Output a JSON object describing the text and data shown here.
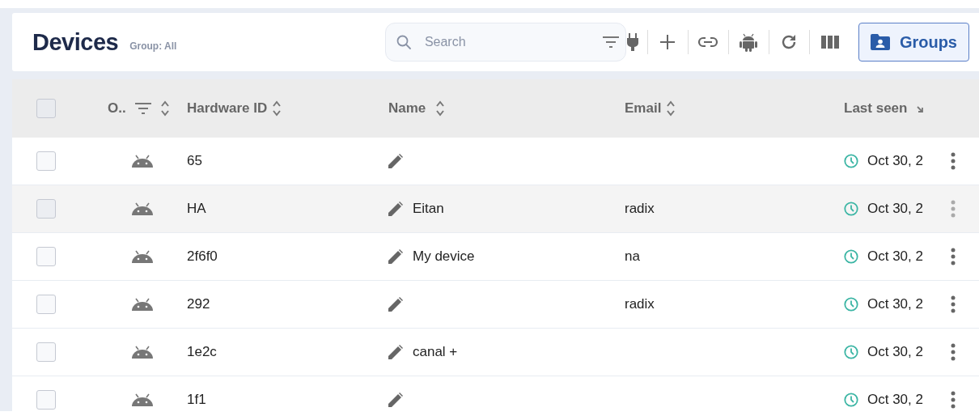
{
  "header": {
    "title": "Devices",
    "subtitle": "Group: All",
    "search": {
      "placeholder": "Search"
    },
    "groups_button": "Groups"
  },
  "table": {
    "select_all": {
      "checked": false
    },
    "columns": [
      {
        "label": "O..",
        "filterable": true,
        "sorted_desc": false
      },
      {
        "label": "Hardware ID",
        "filterable": false,
        "sorted_desc": false
      },
      {
        "label": "Name",
        "filterable": false,
        "sorted_desc": false
      },
      {
        "label": "Email",
        "filterable": false,
        "sorted_desc": false
      },
      {
        "label": "Last seen",
        "filterable": false,
        "sorted_desc": true
      }
    ],
    "rows": [
      {
        "checked": false,
        "hovered": false,
        "hardware_id": "65",
        "last_seen": "Oct 30, 2"
      },
      {
        "checked": false,
        "hovered": true,
        "hardware_id": "HA",
        "name": "Eitan",
        "email": "radix",
        "last_seen": "Oct 30, 2"
      },
      {
        "checked": false,
        "hovered": false,
        "hardware_id": "2f6f0",
        "name": "My device",
        "email": "na",
        "last_seen": "Oct 30, 2"
      },
      {
        "checked": false,
        "hovered": false,
        "hardware_id": "292",
        "email": "radix",
        "last_seen": "Oct 30, 2"
      },
      {
        "checked": false,
        "hovered": false,
        "hardware_id": "1e2c",
        "name": "canal +",
        "last_seen": "Oct 30, 2"
      },
      {
        "checked": false,
        "hovered": false,
        "hardware_id": "1f1",
        "last_seen": "Oct 30, 2"
      }
    ]
  }
}
